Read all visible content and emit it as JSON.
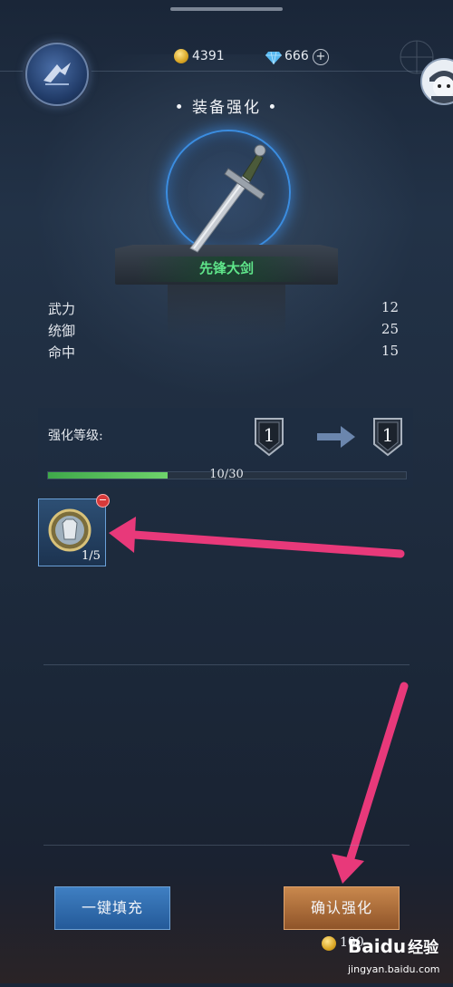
{
  "currency": {
    "gold": "4391",
    "diamonds": "666",
    "add_symbol": "+"
  },
  "header": {
    "title": "装备强化"
  },
  "equipment": {
    "name": "先锋大剑"
  },
  "stats": [
    {
      "label": "武力",
      "value": "12"
    },
    {
      "label": "统御",
      "value": "25"
    },
    {
      "label": "命中",
      "value": "15"
    }
  ],
  "enhance": {
    "label": "强化等级:",
    "current_level": "1",
    "next_level": "1",
    "progress_text": "10/30",
    "progress_fraction": 0.3333
  },
  "material": {
    "count": "1/5",
    "remove_symbol": "−"
  },
  "buttons": {
    "autofill": "一键填充",
    "confirm": "确认强化"
  },
  "cost": {
    "value": "100"
  },
  "watermark": {
    "brand": "Baidu",
    "brand_cn": "经验",
    "url": "jingyan.baidu.com"
  },
  "annotation_color": "#e8397a",
  "colors": {
    "item_name": "#5fe58a",
    "halo": "#3b8de0",
    "progress": "#5ec45c"
  },
  "icons": [
    "logo-icon",
    "gold-coin-icon",
    "diamond-icon",
    "add-icon",
    "avatar-icon",
    "sword-icon",
    "level-shield-icon",
    "arrow-right-icon",
    "armor-icon",
    "remove-icon"
  ]
}
